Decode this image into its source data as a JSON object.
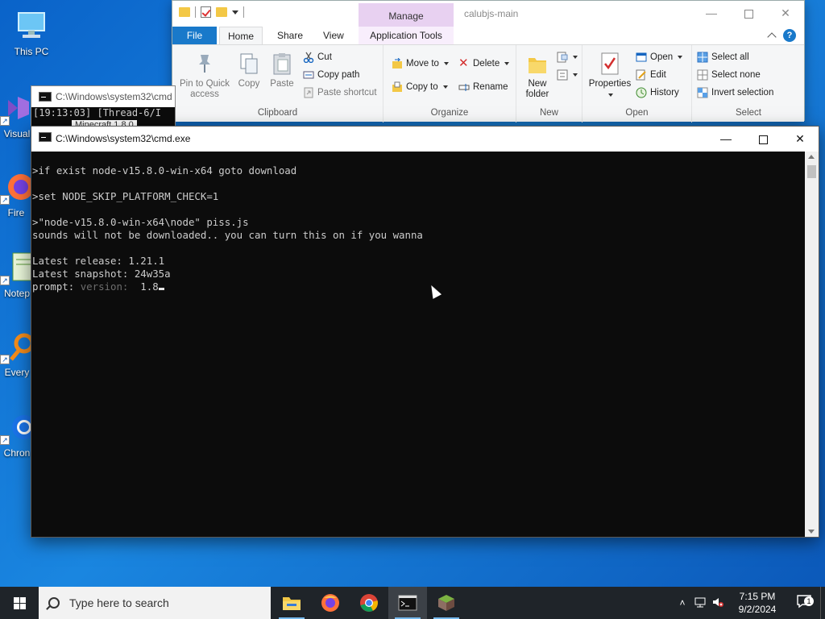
{
  "desktop": {
    "icons": [
      {
        "label": "This PC"
      },
      {
        "label": "Visual"
      },
      {
        "label": "Fire"
      },
      {
        "label": "Notep"
      },
      {
        "label": "Every"
      },
      {
        "label": "Chron"
      }
    ]
  },
  "explorer": {
    "title": "calubjs-main",
    "contextual_tab": "Manage",
    "tabs": [
      "File",
      "Home",
      "Share",
      "View",
      "Application Tools"
    ],
    "groups": {
      "clipboard": {
        "title": "Clipboard",
        "pin": "Pin to Quick access",
        "copy": "Copy",
        "paste": "Paste",
        "cut": "Cut",
        "copy_path": "Copy path",
        "paste_shortcut": "Paste shortcut"
      },
      "organize": {
        "title": "Organize",
        "move_to": "Move to",
        "copy_to": "Copy to",
        "delete": "Delete",
        "rename": "Rename"
      },
      "new": {
        "title": "New",
        "new_folder": "New folder"
      },
      "open": {
        "title": "Open",
        "properties": "Properties",
        "open": "Open",
        "edit": "Edit",
        "history": "History"
      },
      "select": {
        "title": "Select",
        "select_all": "Select all",
        "select_none": "Select none",
        "invert": "Invert selection"
      }
    }
  },
  "cmd_back": {
    "title": "C:\\Windows\\system32\\cmd",
    "line1": "[19:13:03] [Thread-6/I",
    "inner_title": "Minecraft 1.8.0"
  },
  "cmd": {
    "title": "C:\\Windows\\system32\\cmd.exe",
    "lines": {
      "l1": ">if exist node-v15.8.0-win-x64 goto download",
      "l2": ">set NODE_SKIP_PLATFORM_CHECK=1",
      "l3": ">\"node-v15.8.0-win-x64\\node\" piss.js",
      "l4": "sounds will not be downloaded.. you can turn this on if you wanna",
      "l5": "Latest release: 1.21.1",
      "l6": "Latest snapshot: 24w35a",
      "prompt_label": "prompt: ",
      "prompt_hint": "version:  ",
      "prompt_value": "1.8"
    }
  },
  "taskbar": {
    "search_placeholder": "Type here to search",
    "time": "7:15 PM",
    "date": "9/2/2024",
    "notification_count": "1"
  }
}
